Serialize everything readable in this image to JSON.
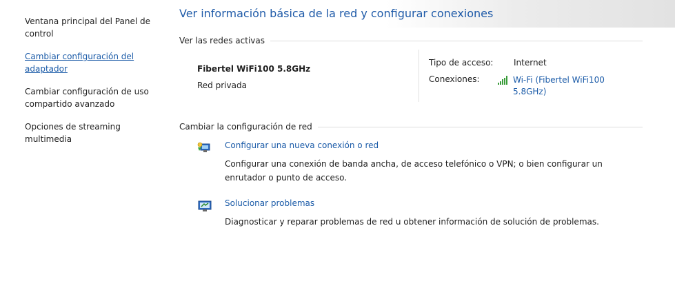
{
  "sidebar": {
    "items": [
      {
        "label": "Ventana principal del Panel de control"
      },
      {
        "label": "Cambiar configuración del adaptador"
      },
      {
        "label": "Cambiar configuración de uso compartido avanzado"
      },
      {
        "label": "Opciones de streaming multimedia"
      }
    ]
  },
  "main": {
    "title": "Ver información básica de la red y configurar conexiones",
    "active_networks_heading": "Ver las redes activas",
    "network": {
      "name": "Fibertel WiFi100 5.8GHz",
      "category": "Red privada",
      "access_type_label": "Tipo de acceso:",
      "access_type_value": "Internet",
      "connections_label": "Conexiones:",
      "connections_value": "Wi-Fi (Fibertel WiFi100 5.8GHz)"
    },
    "change_settings_heading": "Cambiar la configuración de red",
    "tasks": [
      {
        "link": "Configurar una nueva conexión o red",
        "description": "Configurar una conexión de banda ancha, de acceso telefónico o VPN; o bien configurar un enrutador o punto de acceso.",
        "icon": "new-connection-icon"
      },
      {
        "link": "Solucionar problemas",
        "description": "Diagnosticar y reparar problemas de red u obtener información de solución de problemas.",
        "icon": "troubleshoot-icon"
      }
    ]
  },
  "colors": {
    "link": "#1b5ba8",
    "title": "#1e5aa8",
    "signal": "#3a9c3a"
  }
}
